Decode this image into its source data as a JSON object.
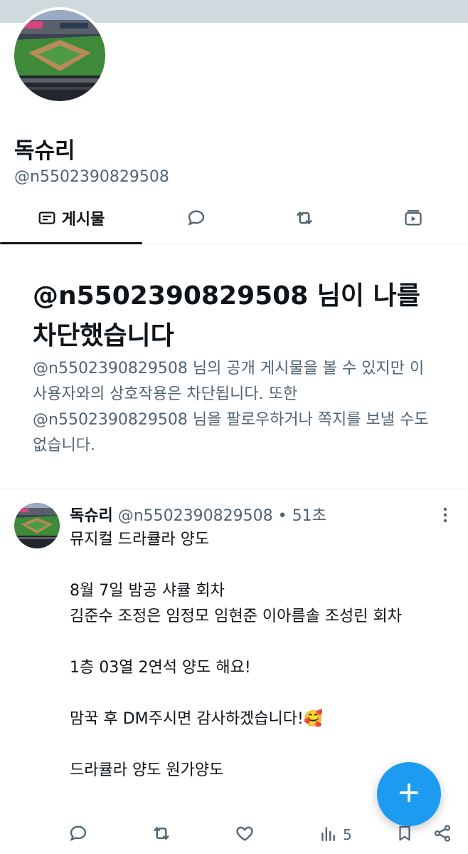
{
  "colors": {
    "accent": "#1d9bf0",
    "text_primary": "#0f1419",
    "text_secondary": "#536471",
    "banner": "#cfd9de"
  },
  "profile": {
    "display_name": "독슈리",
    "handle": "@n5502390829508",
    "avatar_icon": "baseball-stadium-photo"
  },
  "tabs": [
    {
      "label": "게시물",
      "icon": "posts-icon",
      "active": true
    },
    {
      "label": "",
      "icon": "reply-icon",
      "active": false
    },
    {
      "label": "",
      "icon": "repost-icon",
      "active": false
    },
    {
      "label": "",
      "icon": "video-icon",
      "active": false
    }
  ],
  "blocked_notice": {
    "title": "@n5502390829508 님이 나를 차단했습니다",
    "body": "@n5502390829508 님의 공개 게시물을 볼 수 있지만 이 사용자와의 상호작용은 차단됩니다. 또한 @n5502390829508 님을 팔로우하거나 쪽지를 보낼 수도 없습니다."
  },
  "post": {
    "author_name": "독슈리",
    "meta": "@n5502390829508 • 51초",
    "text": "뮤지컬 드라큘라 양도\n\n8월 7일 밤공 샤큘 회차\n김준수 조정은 임정모 임현준 이아름솔 조성린 회차\n\n1층 03열 2연석 양도 해요!\n\n맘꾹 후 DM주시면 감사하겠습니다!🥰\n\n드라큘라 양도 원가양도",
    "views_count": "5",
    "actions": [
      "reply-icon",
      "repost-icon",
      "like-icon",
      "views-icon",
      "bookmark-icon",
      "share-icon"
    ]
  },
  "compose": {
    "icon": "plus-icon"
  }
}
